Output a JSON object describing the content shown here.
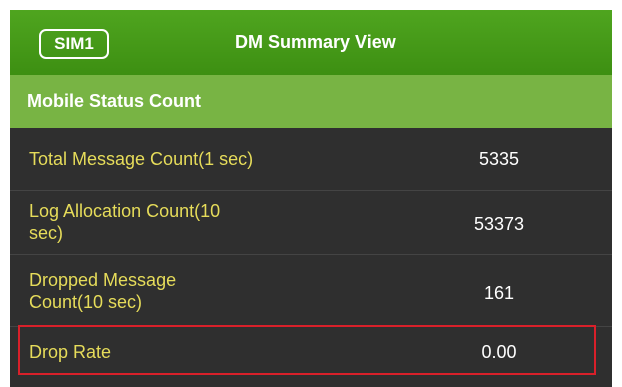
{
  "header": {
    "sim_label": "SIM1",
    "title": "DM Summary View"
  },
  "section": {
    "title": "Mobile Status Count"
  },
  "rows": [
    {
      "label": "Total Message Count(1 sec)",
      "value": "5335"
    },
    {
      "label": "Log Allocation Count(10 sec)",
      "value": "53373"
    },
    {
      "label": "Dropped Message Count(10 sec)",
      "value": "161"
    },
    {
      "label": "Drop Rate",
      "value": "0.00"
    }
  ],
  "colors": {
    "header_green": "#4fa51f",
    "section_green": "#78b444",
    "background": "#2f2f2f",
    "label_yellow": "#e6dc5a",
    "highlight_red": "#d9202a"
  }
}
